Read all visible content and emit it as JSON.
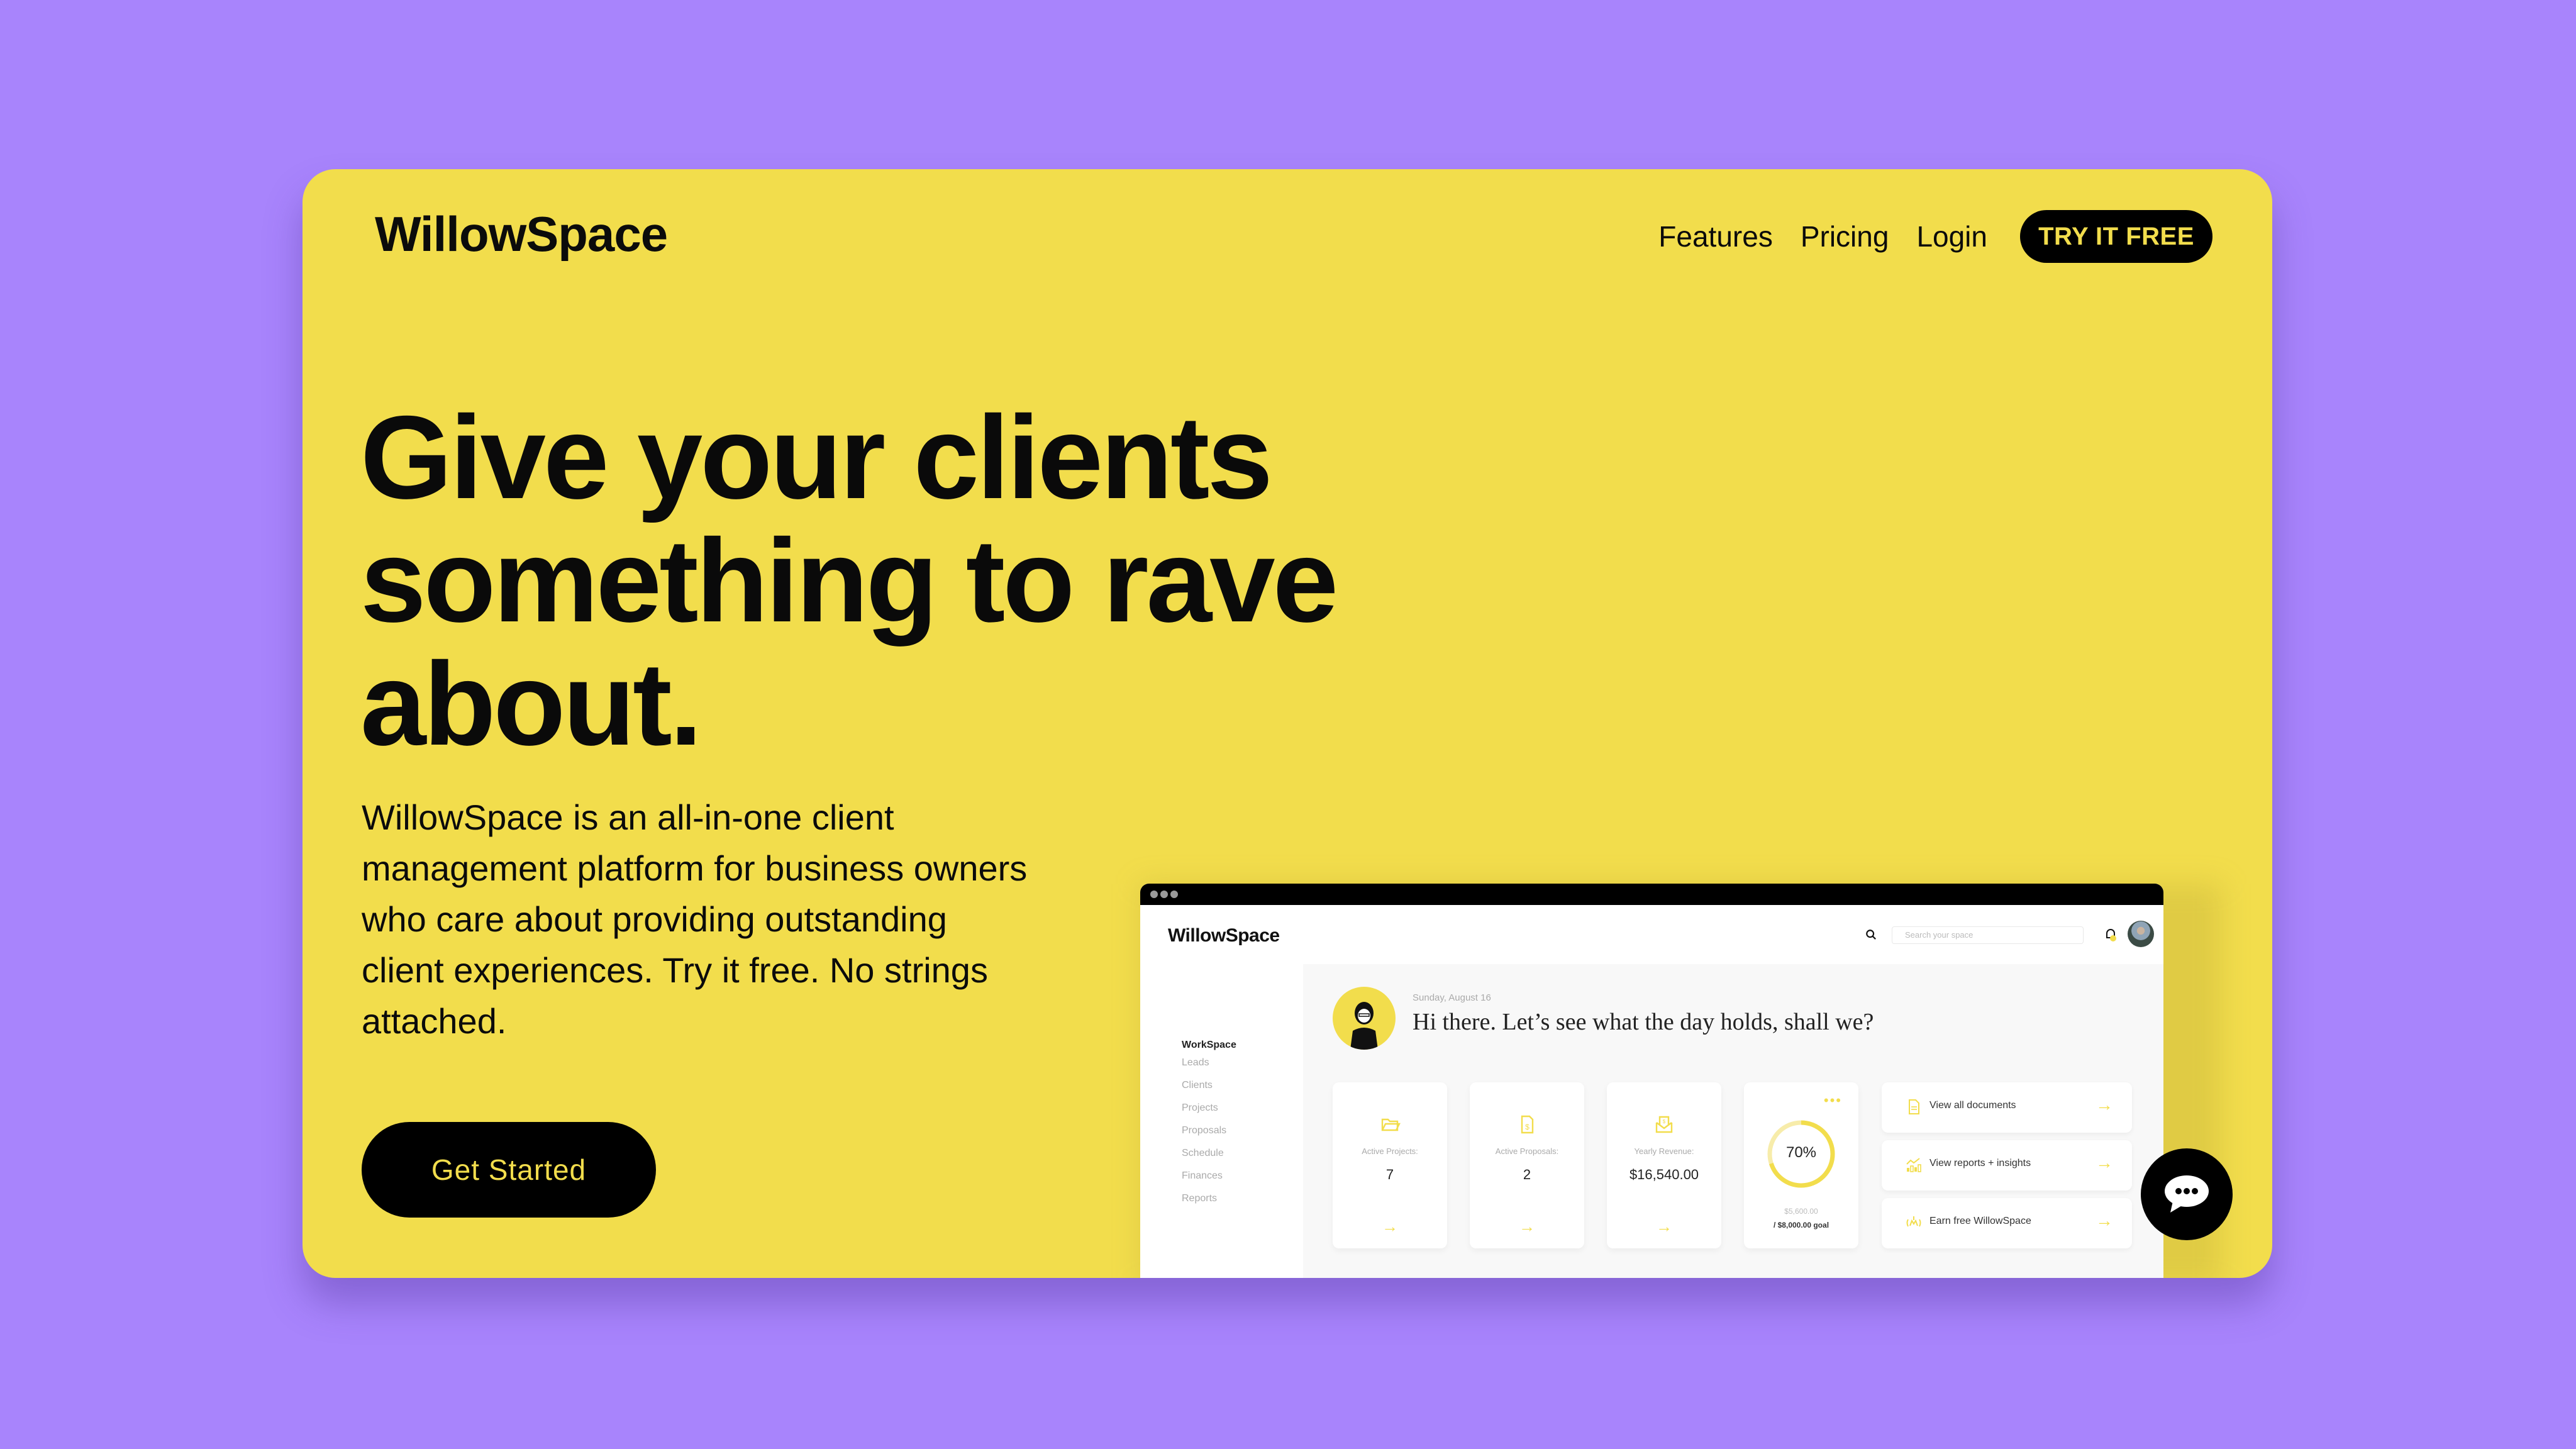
{
  "brand": {
    "name": "WillowSpace",
    "colors": {
      "background": "#a884fc",
      "card": "#f2dd4c",
      "dark": "#000000",
      "accent": "#f2dd4c"
    }
  },
  "nav": {
    "links": [
      "Features",
      "Pricing",
      "Login"
    ],
    "cta_label": "TRY IT FREE"
  },
  "hero": {
    "headline_lines": [
      "Give your clients",
      "something to rave",
      "about."
    ],
    "description": "WillowSpace is an all-in-one client management platform for business owners who care about providing outstanding client experiences. Try it free. No strings attached.",
    "cta_label": "Get Started"
  },
  "mockup": {
    "logo": "WillowSpace",
    "search_placeholder": "Search your space",
    "icons": {
      "search": "search-icon",
      "notification": "bell-icon",
      "avatar": "user-avatar"
    },
    "sidebar": {
      "section": "WorkSpace",
      "items": [
        "Leads",
        "Clients",
        "Projects",
        "Proposals",
        "Schedule",
        "Finances",
        "Reports"
      ]
    },
    "greeting": {
      "date": "Sunday, August 16",
      "message": "Hi there. Let’s see what the day holds, shall we?"
    },
    "stats": [
      {
        "icon": "folder-icon",
        "label": "Active Projects:",
        "value": "7",
        "arrow": "→"
      },
      {
        "icon": "invoice-icon",
        "label": "Active Proposals:",
        "value": "2",
        "arrow": "→"
      },
      {
        "icon": "revenue-envelope-icon",
        "label": "Yearly Revenue:",
        "value": "$16,540.00",
        "arrow": "→"
      }
    ],
    "goal": {
      "percent_label": "70%",
      "progress": 0.7,
      "current": "$5,600.00",
      "target": "/ $8,000.00 goal",
      "menu": "•••"
    },
    "links": [
      {
        "icon": "document-icon",
        "label": "View all documents",
        "arrow": "→"
      },
      {
        "icon": "chart-icon",
        "label": "View reports + insights",
        "arrow": "→"
      },
      {
        "icon": "gift-icon",
        "label": "Earn free WillowSpace",
        "arrow": "→"
      }
    ]
  },
  "chat": {
    "icon": "chat-bubble-icon"
  }
}
